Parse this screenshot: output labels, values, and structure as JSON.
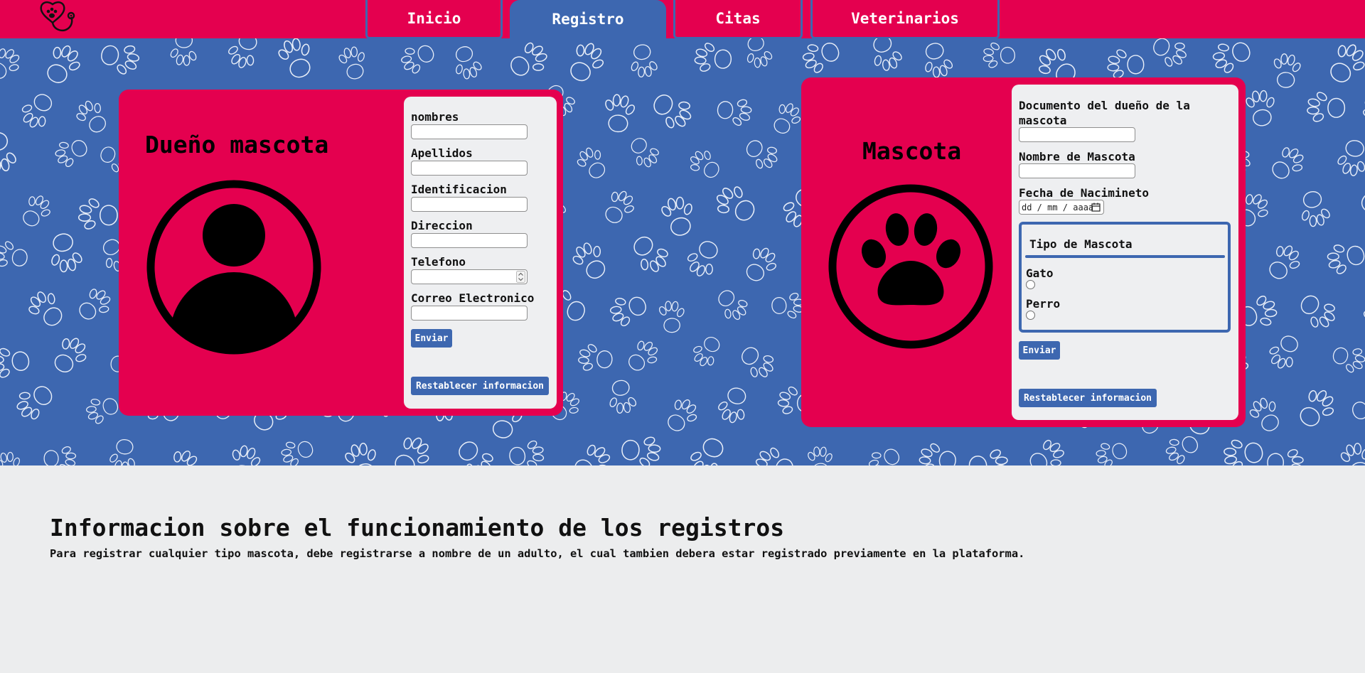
{
  "nav": {
    "tabs": [
      {
        "label": "Inicio"
      },
      {
        "label": "Registro"
      },
      {
        "label": "Citas"
      },
      {
        "label": "Veterinarios"
      }
    ],
    "active_tab": "Registro"
  },
  "colors": {
    "brand_pink": "#e4004f",
    "brand_blue": "#3d67b0",
    "panel_bg": "#eeeff1",
    "page_bg": "#ecedee"
  },
  "owner_card": {
    "title": "Dueño mascota",
    "icon": "person-avatar-icon",
    "fields": [
      {
        "label": "nombres",
        "value": ""
      },
      {
        "label": "Apellidos",
        "value": ""
      },
      {
        "label": "Identificacion",
        "value": ""
      },
      {
        "label": "Direccion",
        "value": ""
      },
      {
        "label": "Telefono",
        "value": ""
      },
      {
        "label": "Correo Electronico",
        "value": ""
      }
    ],
    "submit_label": "Enviar",
    "reset_label": "Restablecer informacion"
  },
  "pet_card": {
    "title": "Mascota",
    "icon": "paw-icon",
    "fields": [
      {
        "label": "Documento del dueño de la mascota",
        "value": ""
      },
      {
        "label": "Nombre de Mascota",
        "value": ""
      },
      {
        "label": "Fecha de Nacimineto",
        "value": "",
        "placeholder": "dd / mm / aaaa"
      }
    ],
    "pet_type": {
      "legend": "Tipo de Mascota",
      "options": [
        {
          "label": "Gato",
          "checked": false
        },
        {
          "label": "Perro",
          "checked": false
        }
      ]
    },
    "submit_label": "Enviar",
    "reset_label": "Restablecer informacion"
  },
  "info": {
    "title": "Informacion sobre el funcionamiento de los registros",
    "text": "Para registrar cualquier tipo mascota, debe registrarse a nombre de un adulto, el cual tambien debera estar registrado previamente en la plataforma."
  }
}
